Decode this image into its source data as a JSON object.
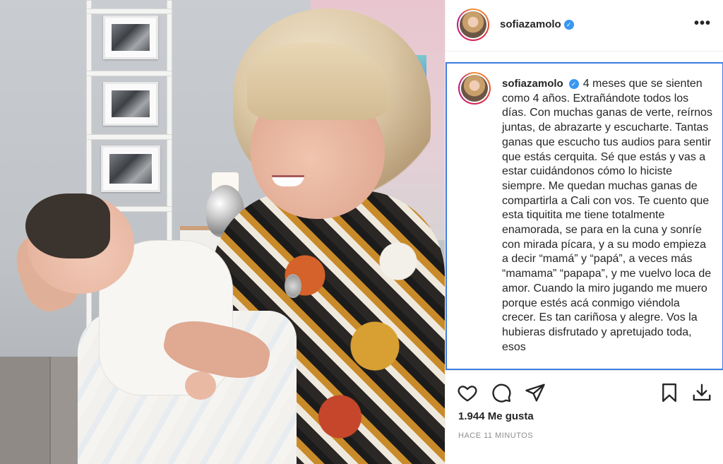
{
  "post": {
    "username": "sofiazamolo",
    "verified": true,
    "caption": "4 meses que se sienten como 4 años. Extrañándote todos los días. Con muchas ganas de verte, reírnos juntas, de abrazarte y escucharte. Tantas ganas que escucho tus audios para sentir que estás cerquita. Sé que estás y vas a estar cuidándonos cómo lo hiciste siempre. Me quedan muchas ganas de compartirla a Cali con vos. Te cuento que esta tiquitita me tiene totalmente enamorada, se para en la cuna y sonríe con mirada pícara, y a su modo empieza a decir “mamá” y “papá”, a veces más “mamama” “papapa”, y me vuelvo loca de amor. Cuando la miro jugando me muero porque estés acá conmigo viéndola crecer. Es tan cariñosa y alegre. Vos la hubieras disfrutado y apretujado toda, esos",
    "likes": "1.944 Me gusta",
    "timestamp": "HACE 11 MINUTOS"
  },
  "icons": {
    "verified": "verified-badge-icon",
    "more": "more-options-icon",
    "like": "heart-icon",
    "comment": "comment-icon",
    "share": "send-icon",
    "save": "bookmark-icon",
    "download": "download-icon"
  },
  "colors": {
    "verified_blue": "#3897f0",
    "selection_border": "#3f7de0",
    "timestamp_gray": "#8e8e8e"
  }
}
